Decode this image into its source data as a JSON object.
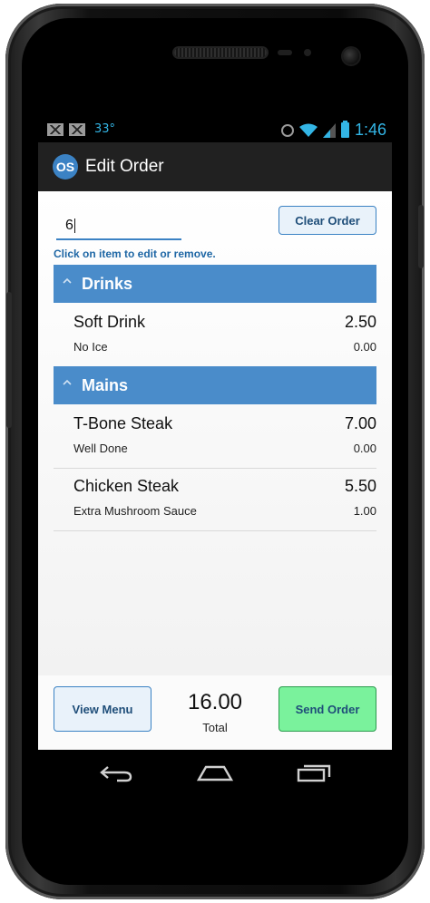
{
  "statusbar": {
    "temperature": "33°",
    "time": "1:46",
    "icons": [
      "gmail-icon",
      "gmail-icon",
      "alarm-icon",
      "wifi-icon",
      "signal-icon",
      "battery-icon"
    ]
  },
  "actionbar": {
    "logo_text": "OS",
    "title": "Edit Order"
  },
  "order": {
    "table_input_value": "6",
    "clear_button": "Clear Order",
    "hint": "Click on item to edit or remove."
  },
  "sections": [
    {
      "label": "Drinks",
      "items": [
        {
          "name": "Soft Drink",
          "price": "2.50",
          "note": "No Ice",
          "note_price": "0.00"
        }
      ]
    },
    {
      "label": "Mains",
      "items": [
        {
          "name": "T-Bone Steak",
          "price": "7.00",
          "note": "Well Done",
          "note_price": "0.00"
        },
        {
          "name": "Chicken Steak",
          "price": "5.50",
          "note": "Extra Mushroom Sauce",
          "note_price": "1.00"
        }
      ]
    }
  ],
  "footer": {
    "view_menu": "View Menu",
    "total_value": "16.00",
    "total_label": "Total",
    "send_order": "Send Order"
  },
  "colors": {
    "accent": "#4a8cca",
    "send": "#7af29c",
    "status": "#33b5e5"
  }
}
